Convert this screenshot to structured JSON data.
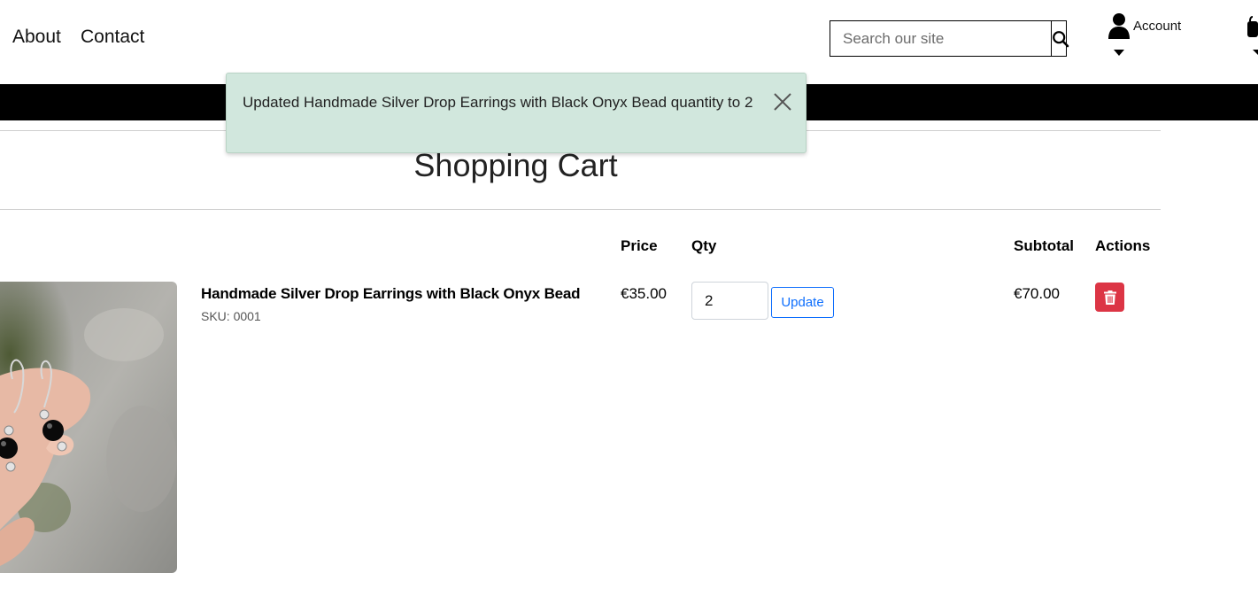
{
  "header": {
    "nav": [
      {
        "label": "About"
      },
      {
        "label": "Contact"
      }
    ],
    "search": {
      "placeholder": "Search our site",
      "icon": "search-icon"
    },
    "account": {
      "label": "Account",
      "icon": "user-icon"
    },
    "bag": {
      "icon": "shopping-bag-icon"
    }
  },
  "toast": {
    "message": "Updated Handmade Silver Drop Earrings with Black Onyx Bead quantity to 2",
    "close_icon": "close-icon",
    "background": "#d1e7dd"
  },
  "page": {
    "title": "Shopping Cart"
  },
  "table": {
    "headers": {
      "price": "Price",
      "qty": "Qty",
      "subtotal": "Subtotal",
      "actions": "Actions"
    }
  },
  "cart": {
    "items": [
      {
        "name": "Handmade Silver Drop Earrings with Black Onyx Bead",
        "sku": "SKU: 0001",
        "price": "€35.00",
        "quantity": "2",
        "update_label": "Update",
        "subtotal": "€70.00",
        "delete_icon": "trash-icon"
      }
    ]
  },
  "colors": {
    "accent_blue": "#0d6efd",
    "danger_red": "#dc3545",
    "toast_green": "#d1e7dd",
    "bar_black": "#000000"
  }
}
